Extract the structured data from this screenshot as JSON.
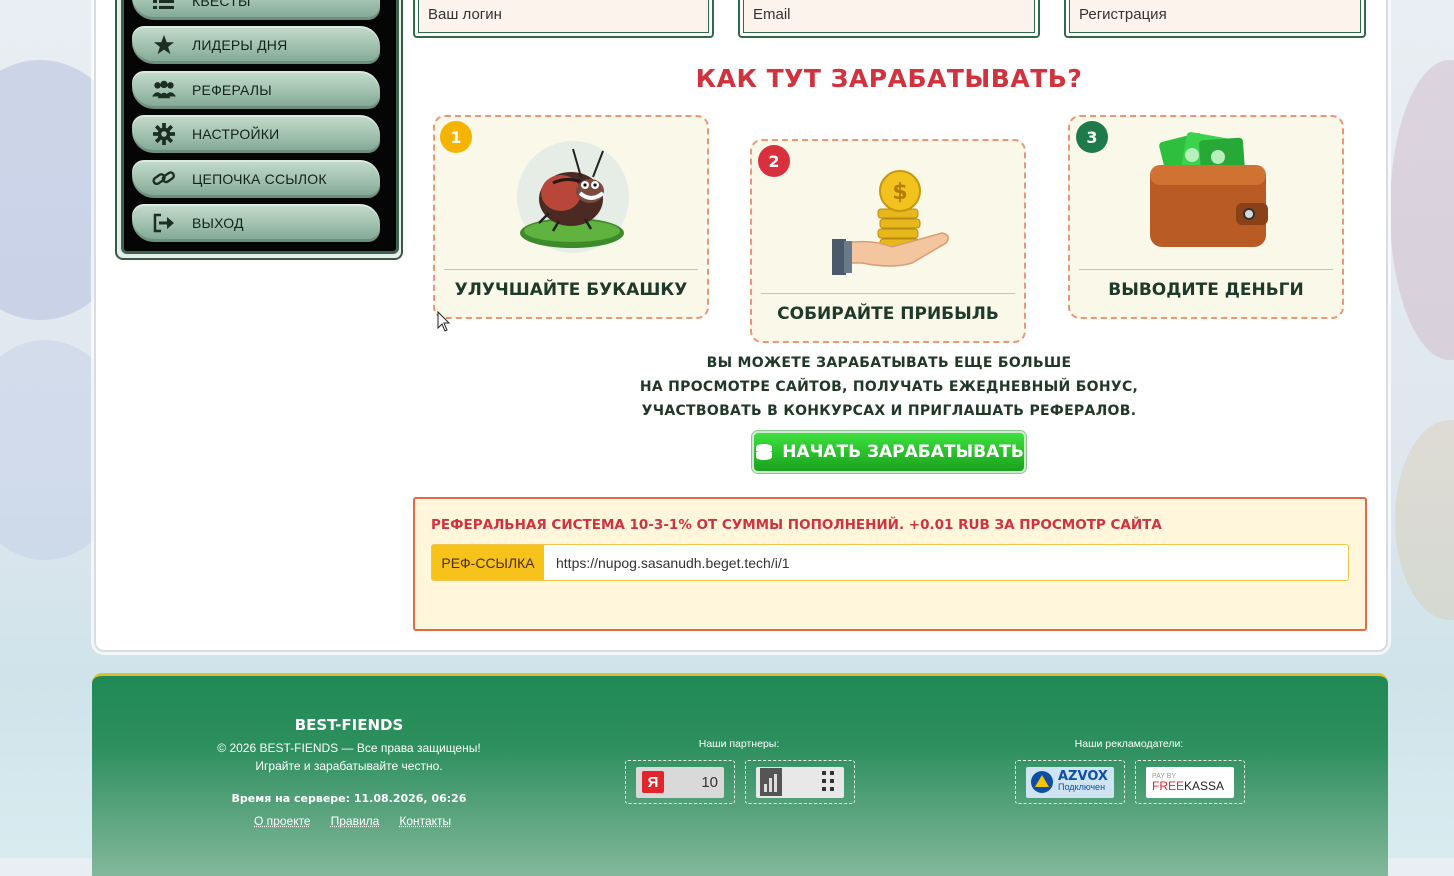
{
  "menu": {
    "items": [
      {
        "label": "КВЕСТЫ",
        "icon": "list-icon"
      },
      {
        "label": "ЛИДЕРЫ ДНЯ",
        "icon": "star-icon"
      },
      {
        "label": "РЕФЕРАЛЫ",
        "icon": "users-icon"
      },
      {
        "label": "НАСТРОЙКИ",
        "icon": "gear-icon"
      },
      {
        "label": "ЦЕПОЧКА ССЫЛОК",
        "icon": "link-icon"
      },
      {
        "label": "ВЫХОД",
        "icon": "logout-icon"
      }
    ]
  },
  "auth": {
    "login_placeholder": "Ваш логин",
    "email_placeholder": "Email",
    "register_label": "Регистрация"
  },
  "how": {
    "title": "КАК ТУТ ЗАРАБАТЫВАТЬ?",
    "steps": [
      {
        "num": "1",
        "caption": "УЛУЧШАЙТЕ БУКАШКУ",
        "icon": "bug-icon"
      },
      {
        "num": "2",
        "caption": "СОБИРАЙТЕ ПРИБЫЛЬ",
        "icon": "coins-hand-icon"
      },
      {
        "num": "3",
        "caption": "ВЫВОДИТЕ ДЕНЬГИ",
        "icon": "wallet-icon"
      }
    ],
    "promo_lines": [
      "ВЫ МОЖЕТЕ ЗАРАБАТЫВАТЬ ЕЩЕ БОЛЬШЕ",
      "НА ПРОСМОТРЕ САЙТОВ, ПОЛУЧАТЬ ЕЖЕДНЕВНЫЙ БОНУС,",
      "УЧАСТВОВАТЬ В КОНКУРСАХ И ПРИГЛАШАТЬ РЕФЕРАЛОВ."
    ],
    "start_button": "НАЧАТЬ ЗАРАБАТЫВАТЬ"
  },
  "referral": {
    "title": "РЕФЕРАЛЬНАЯ СИСТЕМА 10-3-1% ОТ СУММЫ ПОПОЛНЕНИЙ. +0.01 RUB ЗА ПРОСМОТР САЙТА",
    "link_label": "РЕФ-ССЫЛКА",
    "link_value": "https://nupog.sasanudh.beget.tech/i/1"
  },
  "footer": {
    "brand": "BEST-FIENDS",
    "copyright": "© 2026 BEST-FIENDS — Все права защищены!",
    "tagline": "Играйте и зарабатывайте честно.",
    "server_time": "Время на сервере: 11.08.2026, 06:26",
    "links": [
      "О проекте",
      "Правила",
      "Контакты"
    ],
    "partners_title": "Наши партнеры:",
    "yandex_letter": "Я",
    "yandex_count": "10",
    "advertisers_title": "Наши рекламодатели:",
    "azvox_name": "AZVOX",
    "azvox_sub": "Подключен",
    "freekassa_pay": "PAY BY",
    "freekassa_free": "FREE",
    "freekassa_kassa": "KASSA"
  },
  "colors": {
    "accent_red": "#d0323e",
    "green_button": "#18a21d",
    "footer_green": "#1f8a55",
    "ref_yellow": "#f7c21a"
  }
}
